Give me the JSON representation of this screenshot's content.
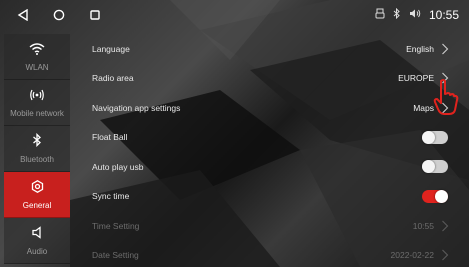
{
  "statusbar": {
    "time": "10:55",
    "icons": [
      "back-triangle-icon",
      "home-circle-icon",
      "recent-square-icon",
      "usb-icon",
      "bluetooth-icon",
      "volume-icon"
    ]
  },
  "sidebar": {
    "items": [
      {
        "label": "WLAN",
        "icon": "wifi-icon",
        "active": false
      },
      {
        "label": "Mobile network",
        "icon": "signal-icon",
        "active": false
      },
      {
        "label": "Bluetooth",
        "icon": "bluetooth-icon",
        "active": false
      },
      {
        "label": "General",
        "icon": "gear-icon",
        "active": true
      },
      {
        "label": "Audio",
        "icon": "speaker-icon",
        "active": false
      }
    ]
  },
  "settings": {
    "language": {
      "label": "Language",
      "value": "English"
    },
    "radio_area": {
      "label": "Radio area",
      "value": "EUROPE"
    },
    "nav_app": {
      "label": "Navigation app settings",
      "value": "Maps"
    },
    "float_ball": {
      "label": "Float Ball",
      "on": false
    },
    "auto_play_usb": {
      "label": "Auto play usb",
      "on": false
    },
    "sync_time": {
      "label": "Sync time",
      "on": true
    },
    "time_setting": {
      "label": "Time Setting",
      "value": "10:55"
    },
    "date_setting": {
      "label": "Date Setting",
      "value": "2022-02-22"
    }
  },
  "colors": {
    "accent": "#c8201e",
    "toggle_on": "#e0231e"
  }
}
